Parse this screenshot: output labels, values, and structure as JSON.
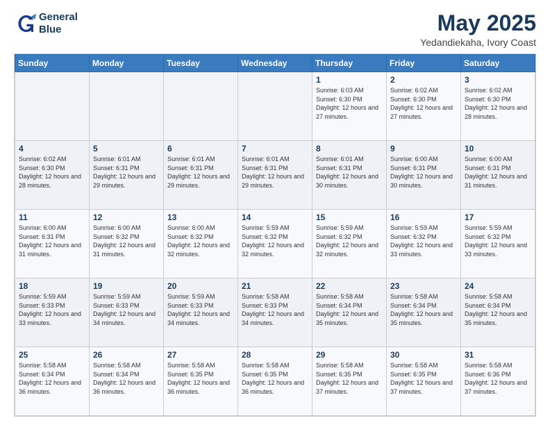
{
  "logo": {
    "line1": "General",
    "line2": "Blue"
  },
  "title": "May 2025",
  "location": "Yedandiekaha, Ivory Coast",
  "days_of_week": [
    "Sunday",
    "Monday",
    "Tuesday",
    "Wednesday",
    "Thursday",
    "Friday",
    "Saturday"
  ],
  "weeks": [
    [
      {
        "day": "",
        "info": ""
      },
      {
        "day": "",
        "info": ""
      },
      {
        "day": "",
        "info": ""
      },
      {
        "day": "",
        "info": ""
      },
      {
        "day": "1",
        "info": "Sunrise: 6:03 AM\nSunset: 6:30 PM\nDaylight: 12 hours and 27 minutes."
      },
      {
        "day": "2",
        "info": "Sunrise: 6:02 AM\nSunset: 6:30 PM\nDaylight: 12 hours and 27 minutes."
      },
      {
        "day": "3",
        "info": "Sunrise: 6:02 AM\nSunset: 6:30 PM\nDaylight: 12 hours and 28 minutes."
      }
    ],
    [
      {
        "day": "4",
        "info": "Sunrise: 6:02 AM\nSunset: 6:30 PM\nDaylight: 12 hours and 28 minutes."
      },
      {
        "day": "5",
        "info": "Sunrise: 6:01 AM\nSunset: 6:31 PM\nDaylight: 12 hours and 29 minutes."
      },
      {
        "day": "6",
        "info": "Sunrise: 6:01 AM\nSunset: 6:31 PM\nDaylight: 12 hours and 29 minutes."
      },
      {
        "day": "7",
        "info": "Sunrise: 6:01 AM\nSunset: 6:31 PM\nDaylight: 12 hours and 29 minutes."
      },
      {
        "day": "8",
        "info": "Sunrise: 6:01 AM\nSunset: 6:31 PM\nDaylight: 12 hours and 30 minutes."
      },
      {
        "day": "9",
        "info": "Sunrise: 6:00 AM\nSunset: 6:31 PM\nDaylight: 12 hours and 30 minutes."
      },
      {
        "day": "10",
        "info": "Sunrise: 6:00 AM\nSunset: 6:31 PM\nDaylight: 12 hours and 31 minutes."
      }
    ],
    [
      {
        "day": "11",
        "info": "Sunrise: 6:00 AM\nSunset: 6:31 PM\nDaylight: 12 hours and 31 minutes."
      },
      {
        "day": "12",
        "info": "Sunrise: 6:00 AM\nSunset: 6:32 PM\nDaylight: 12 hours and 31 minutes."
      },
      {
        "day": "13",
        "info": "Sunrise: 6:00 AM\nSunset: 6:32 PM\nDaylight: 12 hours and 32 minutes."
      },
      {
        "day": "14",
        "info": "Sunrise: 5:59 AM\nSunset: 6:32 PM\nDaylight: 12 hours and 32 minutes."
      },
      {
        "day": "15",
        "info": "Sunrise: 5:59 AM\nSunset: 6:32 PM\nDaylight: 12 hours and 32 minutes."
      },
      {
        "day": "16",
        "info": "Sunrise: 5:59 AM\nSunset: 6:32 PM\nDaylight: 12 hours and 33 minutes."
      },
      {
        "day": "17",
        "info": "Sunrise: 5:59 AM\nSunset: 6:32 PM\nDaylight: 12 hours and 33 minutes."
      }
    ],
    [
      {
        "day": "18",
        "info": "Sunrise: 5:59 AM\nSunset: 6:33 PM\nDaylight: 12 hours and 33 minutes."
      },
      {
        "day": "19",
        "info": "Sunrise: 5:59 AM\nSunset: 6:33 PM\nDaylight: 12 hours and 34 minutes."
      },
      {
        "day": "20",
        "info": "Sunrise: 5:59 AM\nSunset: 6:33 PM\nDaylight: 12 hours and 34 minutes."
      },
      {
        "day": "21",
        "info": "Sunrise: 5:58 AM\nSunset: 6:33 PM\nDaylight: 12 hours and 34 minutes."
      },
      {
        "day": "22",
        "info": "Sunrise: 5:58 AM\nSunset: 6:34 PM\nDaylight: 12 hours and 35 minutes."
      },
      {
        "day": "23",
        "info": "Sunrise: 5:58 AM\nSunset: 6:34 PM\nDaylight: 12 hours and 35 minutes."
      },
      {
        "day": "24",
        "info": "Sunrise: 5:58 AM\nSunset: 6:34 PM\nDaylight: 12 hours and 35 minutes."
      }
    ],
    [
      {
        "day": "25",
        "info": "Sunrise: 5:58 AM\nSunset: 6:34 PM\nDaylight: 12 hours and 36 minutes."
      },
      {
        "day": "26",
        "info": "Sunrise: 5:58 AM\nSunset: 6:34 PM\nDaylight: 12 hours and 36 minutes."
      },
      {
        "day": "27",
        "info": "Sunrise: 5:58 AM\nSunset: 6:35 PM\nDaylight: 12 hours and 36 minutes."
      },
      {
        "day": "28",
        "info": "Sunrise: 5:58 AM\nSunset: 6:35 PM\nDaylight: 12 hours and 36 minutes."
      },
      {
        "day": "29",
        "info": "Sunrise: 5:58 AM\nSunset: 6:35 PM\nDaylight: 12 hours and 37 minutes."
      },
      {
        "day": "30",
        "info": "Sunrise: 5:58 AM\nSunset: 6:35 PM\nDaylight: 12 hours and 37 minutes."
      },
      {
        "day": "31",
        "info": "Sunrise: 5:58 AM\nSunset: 6:36 PM\nDaylight: 12 hours and 37 minutes."
      }
    ]
  ]
}
